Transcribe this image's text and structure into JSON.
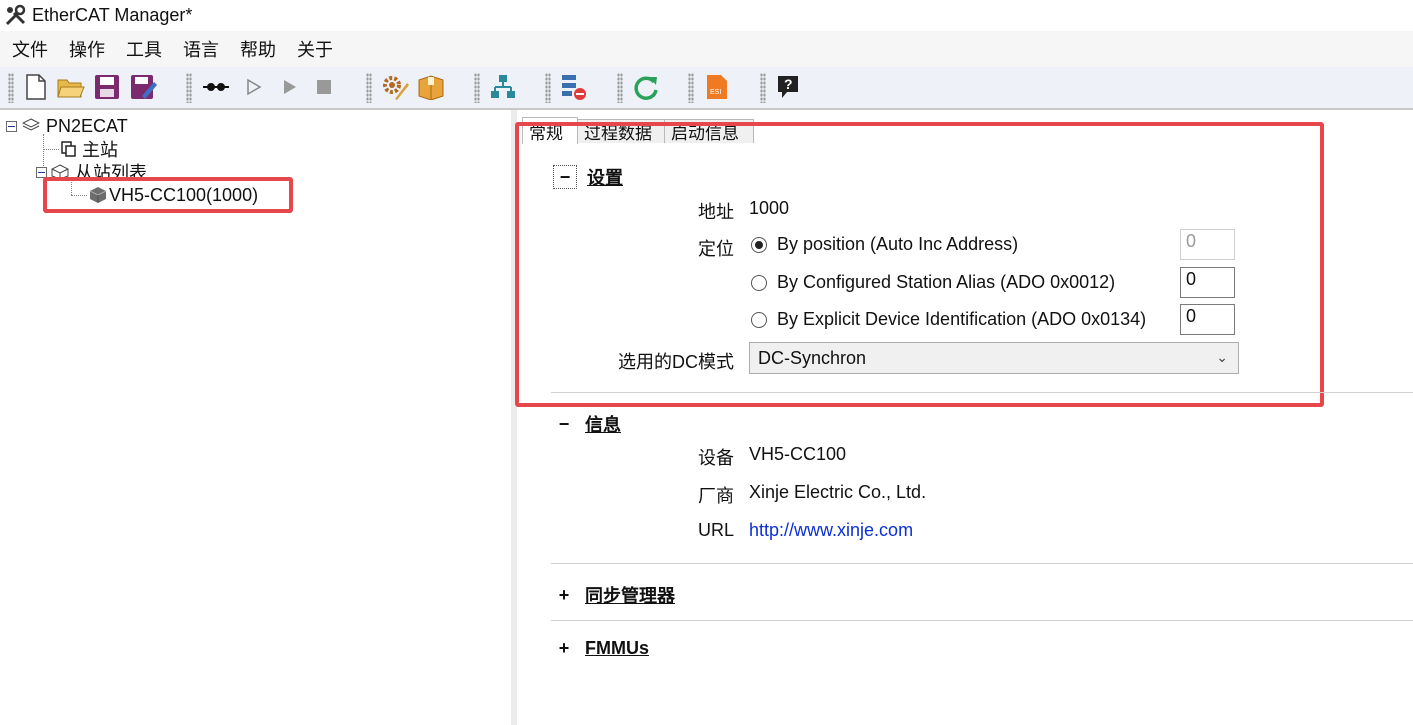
{
  "window": {
    "title": "EtherCAT Manager*"
  },
  "menu": {
    "items": [
      "文件",
      "操作",
      "工具",
      "语言",
      "帮助",
      "关于"
    ]
  },
  "toolbar": {
    "buttons": [
      "new-icon",
      "open-icon",
      "save-icon",
      "save-as-icon",
      "connect-icon",
      "run-outline-icon",
      "run-icon",
      "stop-icon",
      "settings-icon",
      "package-icon",
      "network-tree-icon",
      "config-icon",
      "refresh-icon",
      "esi-icon",
      "help-icon"
    ],
    "esi_label": "ESI",
    "help_label": "?"
  },
  "tree": {
    "root": "PN2ECAT",
    "master": "主站",
    "slave_list": "从站列表",
    "slave": "VH5-CC100(1000)"
  },
  "tabs": [
    "常规",
    "过程数据",
    "启动信息"
  ],
  "settings": {
    "title": "设置",
    "toggle": "−",
    "address_label": "地址",
    "address_value": "1000",
    "position_label": "定位",
    "options": [
      {
        "label": "By position (Auto Inc Address)",
        "value": "0",
        "selected": true,
        "enabled": false
      },
      {
        "label": "By Configured Station Alias (ADO 0x0012)",
        "value": "0",
        "selected": false,
        "enabled": true
      },
      {
        "label": "By Explicit Device Identification (ADO 0x0134)",
        "value": "0",
        "selected": false,
        "enabled": true
      }
    ],
    "dc_label": "选用的DC模式",
    "dc_value": "DC-Synchron"
  },
  "info": {
    "title": "信息",
    "toggle": "−",
    "device_label": "设备",
    "device_value": "VH5-CC100",
    "vendor_label": "厂商",
    "vendor_value": "Xinje Electric Co., Ltd.",
    "url_label": "URL",
    "url_value": "http://www.xinje.com"
  },
  "sync_manager": {
    "title": "同步管理器",
    "toggle": "+"
  },
  "fmmus": {
    "title": "FMMUs",
    "toggle": "+"
  },
  "colors": {
    "highlight": "#e5474b",
    "link": "#0b2fd6"
  }
}
